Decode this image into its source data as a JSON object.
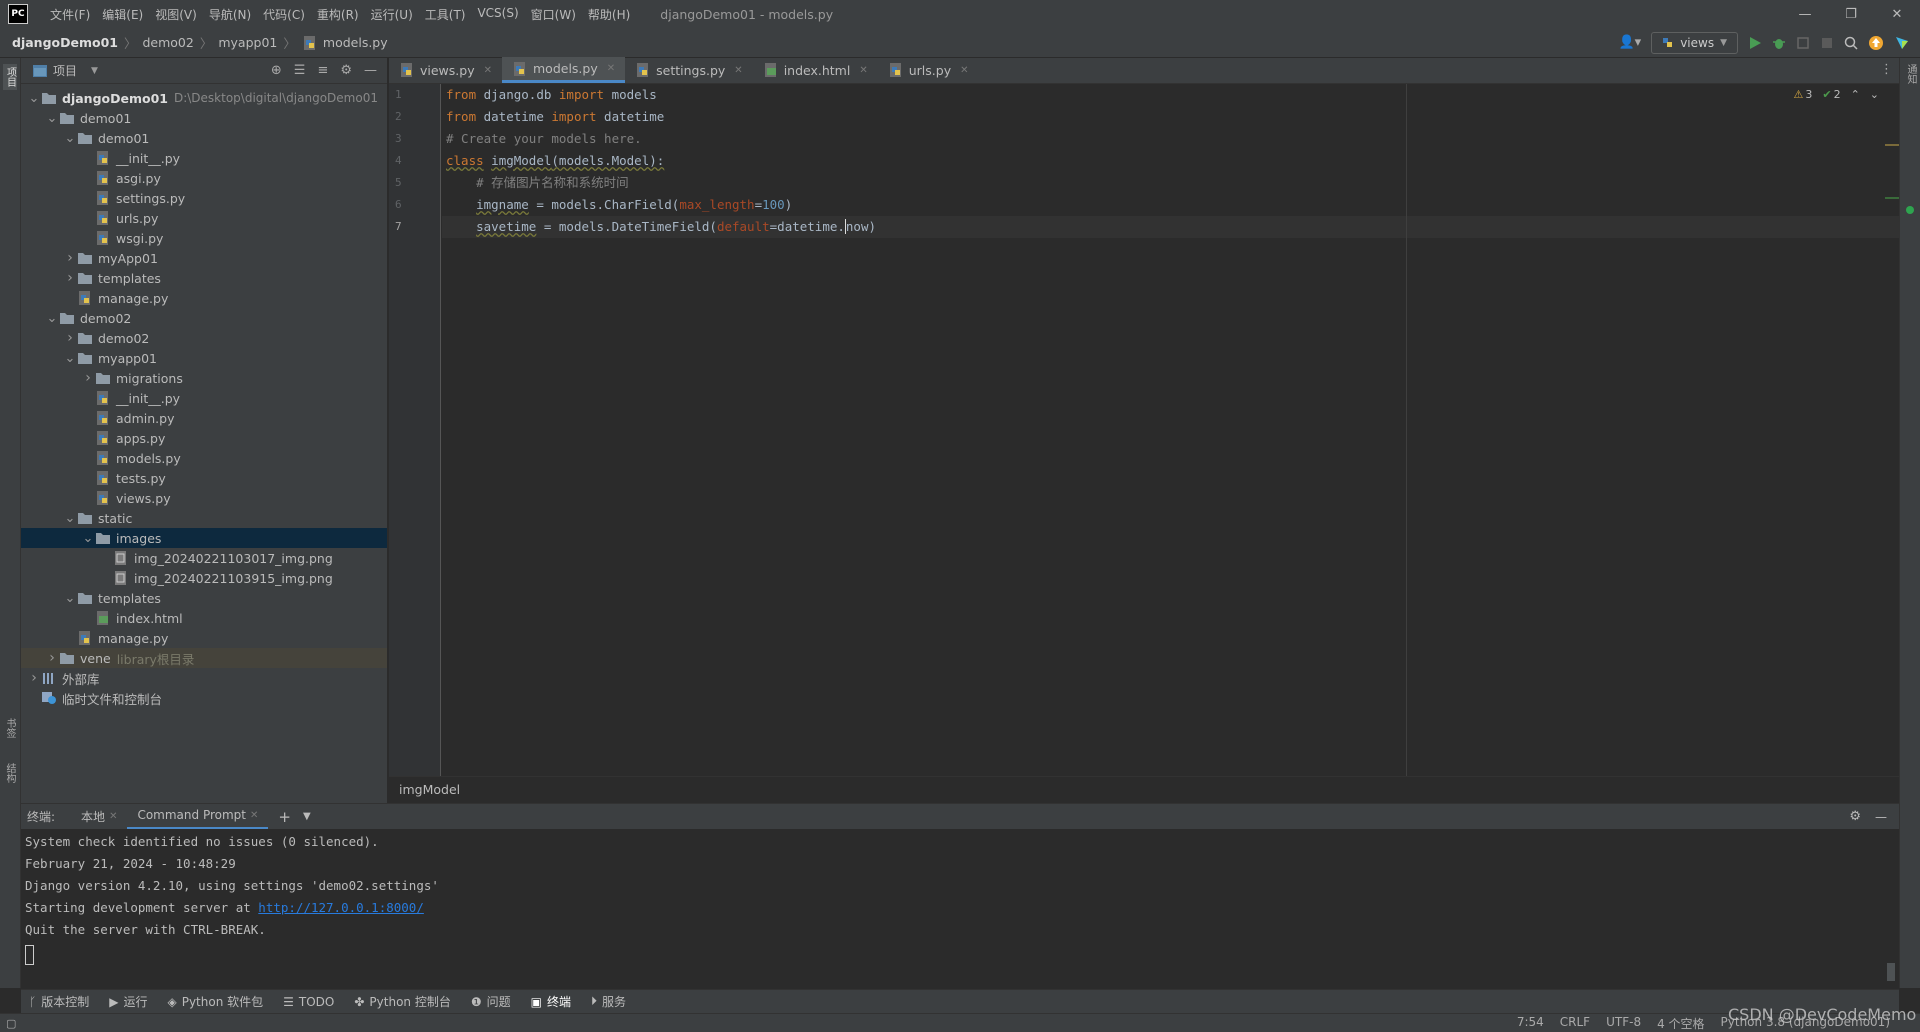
{
  "titlebar": {
    "logo": "PC",
    "menu": [
      "文件(F)",
      "编辑(E)",
      "视图(V)",
      "导航(N)",
      "代码(C)",
      "重构(R)",
      "运行(U)",
      "工具(T)",
      "VCS(S)",
      "窗口(W)",
      "帮助(H)"
    ],
    "window_title": "djangoDemo01 - models.py"
  },
  "navbar": {
    "crumbs": [
      "djangoDemo01",
      "demo02",
      "myapp01",
      "models.py"
    ],
    "run_config": "views"
  },
  "project": {
    "title": "项目",
    "tree": [
      {
        "label": "djangoDemo01",
        "extra": "D:\\Desktop\\digital\\djangoDemo01",
        "depth": 0,
        "arrow": "open",
        "icon": "folder",
        "bold": true
      },
      {
        "label": "demo01",
        "depth": 1,
        "arrow": "open",
        "icon": "folder"
      },
      {
        "label": "demo01",
        "depth": 2,
        "arrow": "open",
        "icon": "folder"
      },
      {
        "label": "__init__.py",
        "depth": 3,
        "icon": "py"
      },
      {
        "label": "asgi.py",
        "depth": 3,
        "icon": "py"
      },
      {
        "label": "settings.py",
        "depth": 3,
        "icon": "py"
      },
      {
        "label": "urls.py",
        "depth": 3,
        "icon": "py"
      },
      {
        "label": "wsgi.py",
        "depth": 3,
        "icon": "py"
      },
      {
        "label": "myApp01",
        "depth": 2,
        "arrow": "closed",
        "icon": "folder"
      },
      {
        "label": "templates",
        "depth": 2,
        "arrow": "closed",
        "icon": "folder"
      },
      {
        "label": "manage.py",
        "depth": 2,
        "icon": "py"
      },
      {
        "label": "demo02",
        "depth": 1,
        "arrow": "open",
        "icon": "folder"
      },
      {
        "label": "demo02",
        "depth": 2,
        "arrow": "closed",
        "icon": "folder"
      },
      {
        "label": "myapp01",
        "depth": 2,
        "arrow": "open",
        "icon": "folder"
      },
      {
        "label": "migrations",
        "depth": 3,
        "arrow": "closed",
        "icon": "folder"
      },
      {
        "label": "__init__.py",
        "depth": 3,
        "icon": "py"
      },
      {
        "label": "admin.py",
        "depth": 3,
        "icon": "py"
      },
      {
        "label": "apps.py",
        "depth": 3,
        "icon": "py"
      },
      {
        "label": "models.py",
        "depth": 3,
        "icon": "py"
      },
      {
        "label": "tests.py",
        "depth": 3,
        "icon": "py"
      },
      {
        "label": "views.py",
        "depth": 3,
        "icon": "py"
      },
      {
        "label": "static",
        "depth": 2,
        "arrow": "open",
        "icon": "folder"
      },
      {
        "label": "images",
        "depth": 3,
        "arrow": "open",
        "icon": "folder",
        "selected": true
      },
      {
        "label": "img_20240221103017_img.png",
        "depth": 4,
        "icon": "img"
      },
      {
        "label": "img_20240221103915_img.png",
        "depth": 4,
        "icon": "img"
      },
      {
        "label": "templates",
        "depth": 2,
        "arrow": "open",
        "icon": "folder"
      },
      {
        "label": "index.html",
        "depth": 3,
        "icon": "html"
      },
      {
        "label": "manage.py",
        "depth": 2,
        "icon": "py"
      },
      {
        "label": "vene",
        "extra": "library根目录",
        "depth": 1,
        "arrow": "closed",
        "icon": "folder",
        "vene": true
      },
      {
        "label": "外部库",
        "depth": 0,
        "arrow": "closed",
        "icon": "lib"
      },
      {
        "label": "临时文件和控制台",
        "depth": 0,
        "icon": "scratch"
      }
    ]
  },
  "tabs": [
    {
      "label": "views.py",
      "icon": "py"
    },
    {
      "label": "models.py",
      "icon": "py",
      "active": true
    },
    {
      "label": "settings.py",
      "icon": "py"
    },
    {
      "label": "index.html",
      "icon": "html"
    },
    {
      "label": "urls.py",
      "icon": "py"
    }
  ],
  "editor": {
    "line_numbers": [
      "1",
      "2",
      "3",
      "4",
      "5",
      "6",
      "7"
    ],
    "current_line": 7,
    "inspections": {
      "warnings": "3",
      "ok": "2"
    },
    "breadcrumb": "imgModel",
    "code": {
      "l1": {
        "a": "from",
        "b": " django.db ",
        "c": "import",
        "d": " models"
      },
      "l2": {
        "a": "from",
        "b": " datetime ",
        "c": "import",
        "d": " datetime"
      },
      "l3": "# Create your models here.",
      "l4": {
        "a": "class",
        "b": "imgModel",
        "c": "(models.Model):"
      },
      "l5": "    # 存储图片名称和系统时间",
      "l6": {
        "a": "    ",
        "b": "imgname",
        "c": " = models.CharField(",
        "d": "max_length",
        "e": "=",
        "f": "100",
        "g": ")"
      },
      "l7": {
        "a": "    ",
        "b": "savetime",
        "c": " = models.DateTimeField(",
        "d": "default",
        "e": "=datetime.",
        "f": "now",
        "g": ")"
      }
    }
  },
  "terminal": {
    "label": "终端:",
    "tabs": [
      {
        "label": "本地"
      },
      {
        "label": "Command Prompt",
        "active": true
      }
    ],
    "lines": {
      "l1": "System check identified no issues (0 silenced).",
      "l2": "February 21, 2024 - 10:48:29",
      "l3": "Django version 4.2.10, using settings 'demo02.settings'",
      "l4a": "Starting development server at ",
      "l4b": "http://127.0.0.1:8000/",
      "l5": "Quit the server with CTRL-BREAK."
    }
  },
  "toolstrip": [
    "版本控制",
    "运行",
    "Python 软件包",
    "TODO",
    "Python 控制台",
    "问题",
    "终端",
    "服务"
  ],
  "statusbar": {
    "position": "7:54",
    "line_sep": "CRLF",
    "encoding": "UTF-8",
    "indent": "4 个空格",
    "interpreter": "Python 3.8 (djangoDemo01)"
  },
  "watermark": "CSDN @DevCodeMemo",
  "side": {
    "left_top": "项目",
    "left_bottom1": "书签",
    "left_bottom2": "结构",
    "right": "通知"
  }
}
